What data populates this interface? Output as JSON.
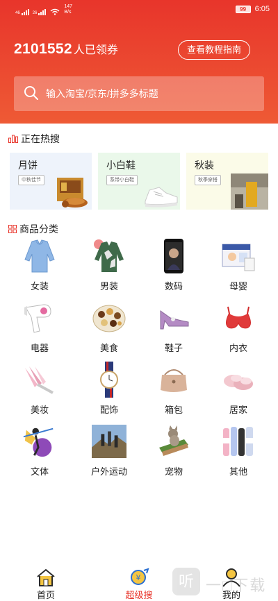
{
  "status_bar": {
    "network_left": "46",
    "network_mid": "26",
    "speed_value": "147",
    "speed_unit": "B/s",
    "battery": "99",
    "time": "6:05"
  },
  "header": {
    "claimed_count": "2101552",
    "claimed_suffix": "人已领券",
    "guide_button": "查看教程指南"
  },
  "search": {
    "placeholder": "输入淘宝/京东/拼多多标题"
  },
  "hot": {
    "title": "正在热搜",
    "items": [
      {
        "name": "月饼",
        "tag": "中秋佳节",
        "bg": "#eef3fb"
      },
      {
        "name": "小白鞋",
        "tag": "系带小白鞋",
        "bg": "#eaf8ea"
      },
      {
        "name": "秋装",
        "tag": "秋季穿搭",
        "bg": "#fbfbe8"
      }
    ]
  },
  "categories": {
    "title": "商品分类",
    "items": [
      {
        "label": "女装",
        "icon": "women-clothing-icon"
      },
      {
        "label": "男装",
        "icon": "men-clothing-icon"
      },
      {
        "label": "数码",
        "icon": "phone-icon"
      },
      {
        "label": "母婴",
        "icon": "baby-products-icon"
      },
      {
        "label": "电器",
        "icon": "hair-dryer-icon"
      },
      {
        "label": "美食",
        "icon": "food-icon"
      },
      {
        "label": "鞋子",
        "icon": "shoe-icon"
      },
      {
        "label": "内衣",
        "icon": "underwear-icon"
      },
      {
        "label": "美妆",
        "icon": "makeup-icon"
      },
      {
        "label": "配饰",
        "icon": "watch-icon"
      },
      {
        "label": "箱包",
        "icon": "bag-icon"
      },
      {
        "label": "居家",
        "icon": "slippers-icon"
      },
      {
        "label": "文体",
        "icon": "sports-icon"
      },
      {
        "label": "户外运动",
        "icon": "outdoor-icon"
      },
      {
        "label": "宠物",
        "icon": "pet-icon"
      },
      {
        "label": "其他",
        "icon": "bottles-icon"
      }
    ]
  },
  "tabbar": {
    "tabs": [
      {
        "label": "首页",
        "icon": "home-icon"
      },
      {
        "label": "超级搜",
        "icon": "super-search-icon"
      },
      {
        "label": "我的",
        "icon": "profile-icon"
      }
    ]
  },
  "watermark": {
    "text": "一□下载",
    "logo_char": "听"
  },
  "colors": {
    "brand_red": "#e8352b",
    "brand_orange": "#ee5a35"
  }
}
